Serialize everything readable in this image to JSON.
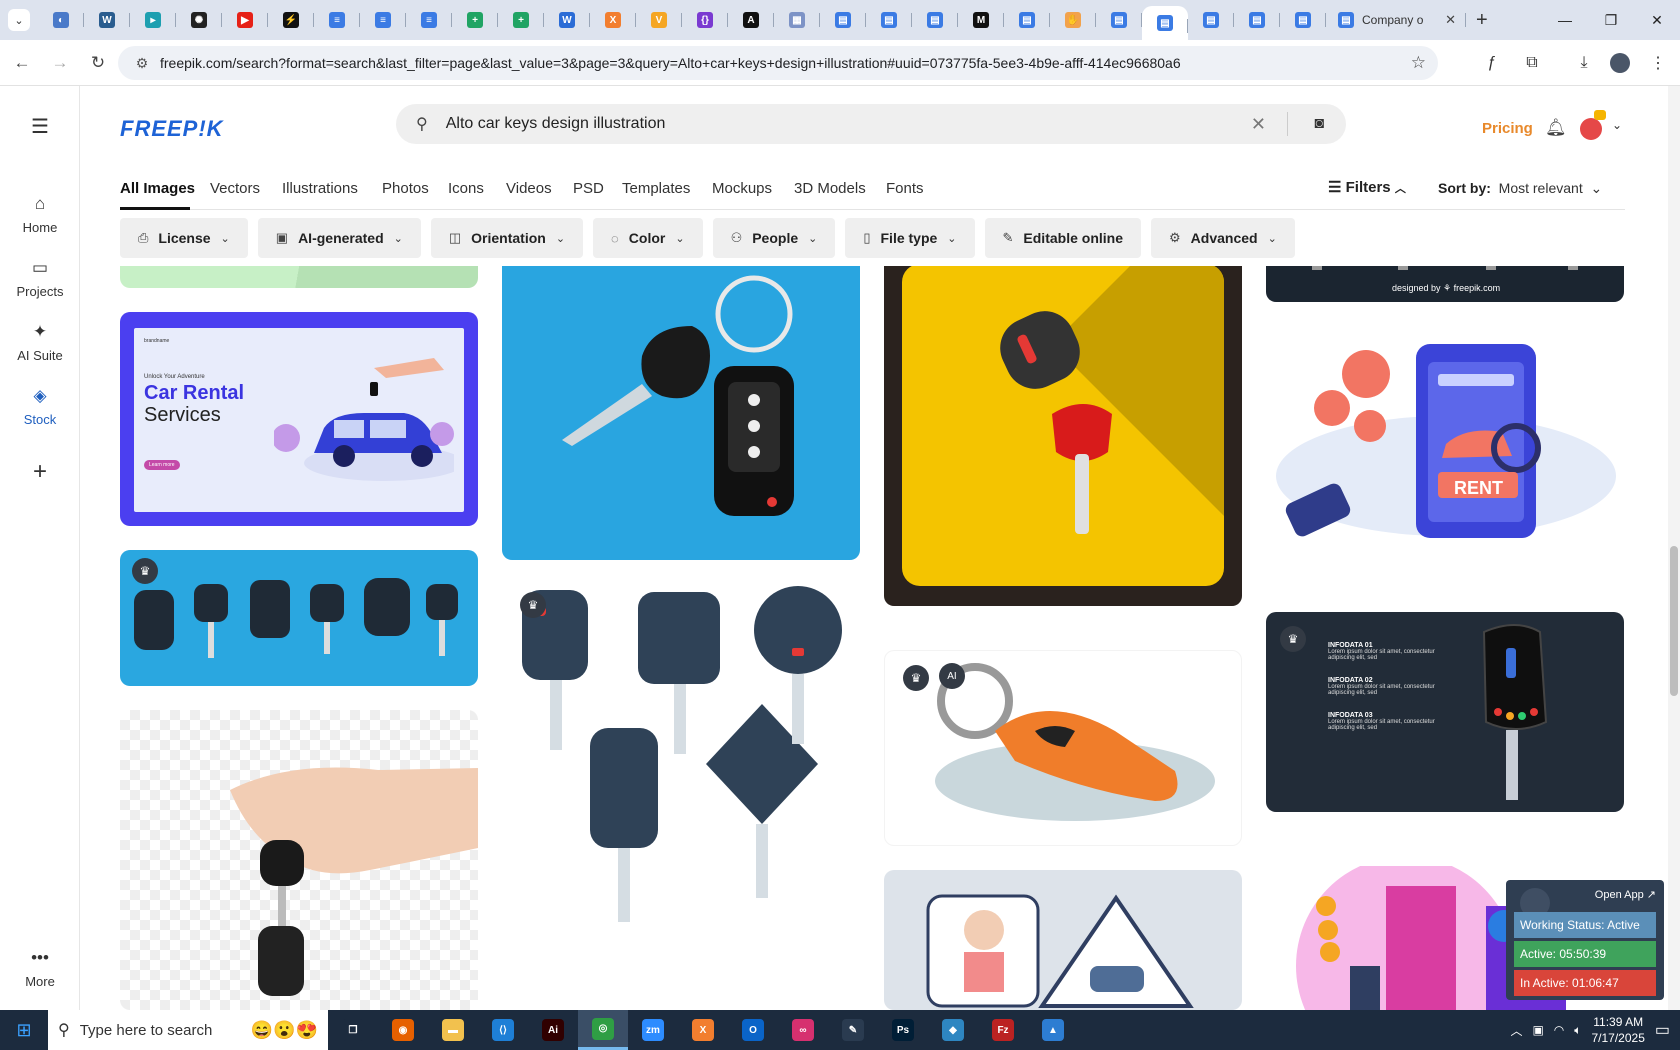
{
  "browser": {
    "tabs": [
      {
        "icon": "globe-icon",
        "color": "#4a7ac9",
        "glyph": "◐"
      },
      {
        "icon": "wordpress-icon",
        "color": "#2a5d8f",
        "glyph": "W"
      },
      {
        "icon": "app-icon",
        "color": "#1d9fb0",
        "glyph": "▸"
      },
      {
        "icon": "openai-icon",
        "color": "#222",
        "glyph": "✺"
      },
      {
        "icon": "youtube-icon",
        "color": "#e62117",
        "glyph": "▶"
      },
      {
        "icon": "bolt-icon",
        "color": "#111",
        "glyph": "⚡"
      },
      {
        "icon": "docs-icon",
        "color": "#3b7be4",
        "glyph": "≡"
      },
      {
        "icon": "docs-icon",
        "color": "#3b7be4",
        "glyph": "≡"
      },
      {
        "icon": "docs-icon",
        "color": "#3b7be4",
        "glyph": "≡"
      },
      {
        "icon": "sheets-icon",
        "color": "#20a464",
        "glyph": "+"
      },
      {
        "icon": "sheets-icon",
        "color": "#20a464",
        "glyph": "+"
      },
      {
        "icon": "word-icon",
        "color": "#2b6cd6",
        "glyph": "W"
      },
      {
        "icon": "xampp-icon",
        "color": "#f27e2f",
        "glyph": "X"
      },
      {
        "icon": "vue-icon",
        "color": "#f5a623",
        "glyph": "V"
      },
      {
        "icon": "code-icon",
        "color": "#7a3ad1",
        "glyph": "{}"
      },
      {
        "icon": "ai-icon",
        "color": "#111",
        "glyph": "A"
      },
      {
        "icon": "grid-icon",
        "color": "#7d93c6",
        "glyph": "▦"
      },
      {
        "icon": "forms-icon",
        "color": "#3b7be4",
        "glyph": "▤"
      },
      {
        "icon": "forms-icon",
        "color": "#3b7be4",
        "glyph": "▤"
      },
      {
        "icon": "forms-icon",
        "color": "#3b7be4",
        "glyph": "▤"
      },
      {
        "icon": "medium-icon",
        "color": "#111",
        "glyph": "M"
      },
      {
        "icon": "forms-icon",
        "color": "#3b7be4",
        "glyph": "▤"
      },
      {
        "icon": "hand-icon",
        "color": "#f2a24b",
        "glyph": "✋"
      },
      {
        "icon": "forms-icon",
        "color": "#3b7be4",
        "glyph": "▤"
      },
      {
        "icon": "forms-icon",
        "color": "#3b7be4",
        "glyph": "▤",
        "active": true
      },
      {
        "icon": "forms-icon",
        "color": "#3b7be4",
        "glyph": "▤"
      },
      {
        "icon": "forms-icon",
        "color": "#3b7be4",
        "glyph": "▤"
      },
      {
        "icon": "forms-icon",
        "color": "#3b7be4",
        "glyph": "▤"
      }
    ],
    "last_tab_title": "Company o",
    "url": "freepik.com/search?format=search&last_filter=page&last_value=3&page=3&query=Alto+car+keys+design+illustration#uuid=073775fa-5ee3-4b9e-afff-414ec96680a6"
  },
  "sidebar": {
    "items": [
      {
        "label": "Home",
        "icon": "home-icon",
        "glyph": "⌂"
      },
      {
        "label": "Projects",
        "icon": "projects-icon",
        "glyph": "▭"
      },
      {
        "label": "AI Suite",
        "icon": "sparkle-icon",
        "glyph": "✦"
      },
      {
        "label": "Stock",
        "icon": "stock-icon",
        "glyph": "◈",
        "active": true
      },
      {
        "label": "",
        "icon": "plus-icon",
        "glyph": "+"
      },
      {
        "label": "More",
        "icon": "more-icon",
        "glyph": "•••"
      }
    ]
  },
  "header": {
    "logo": "FREEP!K",
    "search_value": "Alto car keys design illustration",
    "pricing": "Pricing"
  },
  "categories": {
    "items": [
      "All Images",
      "Vectors",
      "Illustrations",
      "Photos",
      "Icons",
      "Videos",
      "PSD",
      "Templates",
      "Mockups",
      "3D Models",
      "Fonts"
    ],
    "filters_label": "Filters",
    "sort_label": "Sort by:",
    "sort_value": "Most relevant"
  },
  "filters": [
    {
      "label": "License",
      "icon": "license-icon"
    },
    {
      "label": "AI-generated",
      "icon": "ai-generated-icon"
    },
    {
      "label": "Orientation",
      "icon": "orientation-icon"
    },
    {
      "label": "Color",
      "icon": "palette-icon"
    },
    {
      "label": "People",
      "icon": "people-icon"
    },
    {
      "label": "File type",
      "icon": "file-icon"
    },
    {
      "label": "Editable online",
      "icon": "pencil-icon",
      "nochev": true
    },
    {
      "label": "Advanced",
      "icon": "gear-icon"
    }
  ],
  "results": {
    "car_rental": {
      "brand": "brandname",
      "tag": "Unlock Your Adventure",
      "title1": "Car Rental",
      "title2": "Services",
      "btn": "Learn more"
    },
    "rent_label": "RENT",
    "footer_text": "designed by ⚘ freepik.com",
    "infodata": [
      "INFODATA 01",
      "INFODATA 02",
      "INFODATA 03"
    ],
    "info_body": "Lorem ipsum dolor sit amet, consectetur adipiscing elit, sed"
  },
  "widget": {
    "open_app": "Open App ↗",
    "status": "Working Status: Active",
    "active": "Active: 05:50:39",
    "inactive": "In Active: 01:06:47"
  },
  "taskbar": {
    "search_placeholder": "Type here to search",
    "time": "11:39 AM",
    "date": "7/17/2025",
    "apps": [
      {
        "name": "task-view-icon",
        "color": "#1c2b3e",
        "glyph": "❐"
      },
      {
        "name": "firefox-icon",
        "color": "#e66000",
        "glyph": "◉"
      },
      {
        "name": "file-explorer-icon",
        "color": "#f2c14e",
        "glyph": "▬"
      },
      {
        "name": "vscode-icon",
        "color": "#1e7fd6",
        "glyph": "⟨⟩"
      },
      {
        "name": "illustrator-icon",
        "color": "#300000",
        "glyph": "Ai"
      },
      {
        "name": "chrome-icon",
        "color": "#2f9e44",
        "glyph": "◎",
        "active": true
      },
      {
        "name": "zoom-icon",
        "color": "#2d8cff",
        "glyph": "zm"
      },
      {
        "name": "xampp-icon",
        "color": "#f27e2f",
        "glyph": "X"
      },
      {
        "name": "outlook-icon",
        "color": "#0a64c8",
        "glyph": "O"
      },
      {
        "name": "creative-cloud-icon",
        "color": "#d6306f",
        "glyph": "∞"
      },
      {
        "name": "pen-icon",
        "color": "#2a3b50",
        "glyph": "✎"
      },
      {
        "name": "photoshop-icon",
        "color": "#001e36",
        "glyph": "Ps"
      },
      {
        "name": "app-icon",
        "color": "#2e86c1",
        "glyph": "◆"
      },
      {
        "name": "filezilla-icon",
        "color": "#b22",
        "glyph": "Fz"
      },
      {
        "name": "photos-icon",
        "color": "#2d7dd2",
        "glyph": "▲"
      }
    ]
  }
}
